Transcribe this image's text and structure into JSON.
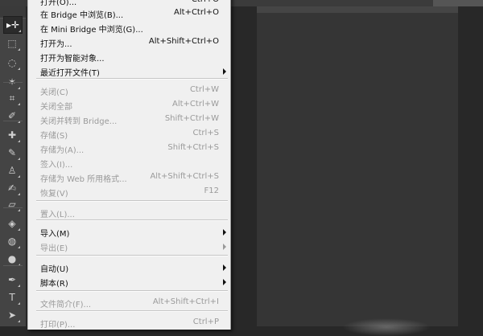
{
  "menu": {
    "items": [
      {
        "label": "打开(O)...",
        "shortcut": "Ctrl+O",
        "disabled": false,
        "submenu": false
      },
      {
        "label": "在 Bridge 中浏览(B)...",
        "shortcut": "Alt+Ctrl+O",
        "disabled": false,
        "submenu": false
      },
      {
        "label": "在 Mini Bridge 中浏览(G)...",
        "shortcut": "",
        "disabled": false,
        "submenu": false
      },
      {
        "label": "打开为...",
        "shortcut": "Alt+Shift+Ctrl+O",
        "disabled": false,
        "submenu": false
      },
      {
        "label": "打开为智能对象...",
        "shortcut": "",
        "disabled": false,
        "submenu": false
      },
      {
        "label": "最近打开文件(T)",
        "shortcut": "",
        "disabled": false,
        "submenu": true
      },
      {
        "label": "关闭(C)",
        "shortcut": "Ctrl+W",
        "disabled": true,
        "submenu": false
      },
      {
        "label": "关闭全部",
        "shortcut": "Alt+Ctrl+W",
        "disabled": true,
        "submenu": false
      },
      {
        "label": "关闭并转到 Bridge...",
        "shortcut": "Shift+Ctrl+W",
        "disabled": true,
        "submenu": false
      },
      {
        "label": "存储(S)",
        "shortcut": "Ctrl+S",
        "disabled": true,
        "submenu": false
      },
      {
        "label": "存储为(A)...",
        "shortcut": "Shift+Ctrl+S",
        "disabled": true,
        "submenu": false
      },
      {
        "label": "签入(I)...",
        "shortcut": "",
        "disabled": true,
        "submenu": false
      },
      {
        "label": "存储为 Web 所用格式...",
        "shortcut": "Alt+Shift+Ctrl+S",
        "disabled": true,
        "submenu": false
      },
      {
        "label": "恢复(V)",
        "shortcut": "F12",
        "disabled": true,
        "submenu": false
      },
      {
        "label": "置入(L)...",
        "shortcut": "",
        "disabled": true,
        "submenu": false
      },
      {
        "label": "导入(M)",
        "shortcut": "",
        "disabled": false,
        "submenu": true
      },
      {
        "label": "导出(E)",
        "shortcut": "",
        "disabled": true,
        "submenu": true
      },
      {
        "label": "自动(U)",
        "shortcut": "",
        "disabled": false,
        "submenu": true
      },
      {
        "label": "脚本(R)",
        "shortcut": "",
        "disabled": false,
        "submenu": true
      },
      {
        "label": "文件简介(F)...",
        "shortcut": "Alt+Shift+Ctrl+I",
        "disabled": true,
        "submenu": false
      },
      {
        "label": "打印(P)...",
        "shortcut": "Ctrl+P",
        "disabled": true,
        "submenu": false
      }
    ]
  },
  "toolbar": {
    "tools": [
      {
        "icon": "move-tool-icon",
        "glyph": "▸✛",
        "active": true
      },
      {
        "icon": "marquee-tool-icon",
        "glyph": "⬚",
        "active": false
      },
      {
        "icon": "lasso-tool-icon",
        "glyph": "◌",
        "active": false
      },
      {
        "icon": "magic-wand-tool-icon",
        "glyph": "✶",
        "active": false
      },
      {
        "icon": "crop-tool-icon",
        "glyph": "⌗",
        "active": false
      },
      {
        "icon": "eyedropper-tool-icon",
        "glyph": "✐",
        "active": false
      },
      {
        "icon": "healing-brush-tool-icon",
        "glyph": "✚",
        "active": false
      },
      {
        "icon": "brush-tool-icon",
        "glyph": "✎",
        "active": false
      },
      {
        "icon": "clone-stamp-tool-icon",
        "glyph": "♙",
        "active": false
      },
      {
        "icon": "history-brush-tool-icon",
        "glyph": "✍",
        "active": false
      },
      {
        "icon": "eraser-tool-icon",
        "glyph": "▱",
        "active": false
      },
      {
        "icon": "paint-bucket-tool-icon",
        "glyph": "◈",
        "active": false
      },
      {
        "icon": "blur-tool-icon",
        "glyph": "◍",
        "active": false
      },
      {
        "icon": "dodge-tool-icon",
        "glyph": "●",
        "active": false
      },
      {
        "icon": "pen-tool-icon",
        "glyph": "✒",
        "active": false
      },
      {
        "icon": "type-tool-icon",
        "glyph": "T",
        "active": false
      },
      {
        "icon": "path-selection-tool-icon",
        "glyph": "➤",
        "active": false
      }
    ]
  }
}
